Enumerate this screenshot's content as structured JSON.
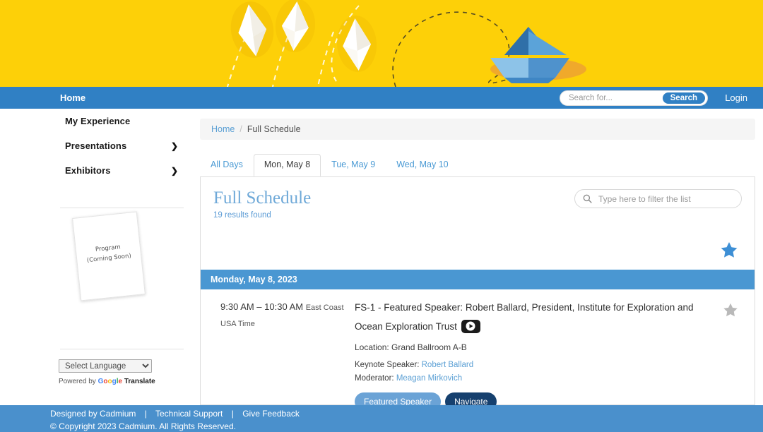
{
  "banner": {
    "alt": "origami kites and paper boat banner",
    "background_color": "#fdd008",
    "boat_color": "#4a90cc"
  },
  "navbar": {
    "home_label": "Home",
    "login_label": "Login",
    "background_color": "#3080c4",
    "search": {
      "placeholder": "Search for...",
      "value": "",
      "button_label": "Search"
    }
  },
  "sidebar": {
    "items": [
      {
        "label": "My Experience",
        "has_chevron": false
      },
      {
        "label": "Presentations",
        "has_chevron": true
      },
      {
        "label": "Exhibitors",
        "has_chevron": true
      }
    ],
    "program_card": {
      "line1": "Program",
      "line2": "(Coming Soon)"
    },
    "language": {
      "selected": "Select Language",
      "options": [
        "Select Language"
      ],
      "powered_by": "Powered by",
      "google": "Google",
      "translate": "Translate"
    }
  },
  "breadcrumb": {
    "home": "Home",
    "separator": "/",
    "current": "Full Schedule"
  },
  "tabs": [
    {
      "label": "All Days",
      "active": false
    },
    {
      "label": "Mon, May 8",
      "active": true
    },
    {
      "label": "Tue, May 9",
      "active": false
    },
    {
      "label": "Wed, May 10",
      "active": false
    }
  ],
  "panel": {
    "title": "Full Schedule",
    "results_found": "19 results found",
    "filter_placeholder": "Type here to filter the list",
    "filter_value": "",
    "star_color": "#3d8fd5"
  },
  "day_header": {
    "label": "Monday, May 8, 2023",
    "background_color": "#4a97d2"
  },
  "session": {
    "time": "9:30 AM – 10:30 AM",
    "timezone": "East Coast USA Time",
    "title": "FS-1 - Featured Speaker: Robert Ballard, President, Institute for Exploration and Ocean Exploration Trust",
    "has_video": true,
    "location_label": "Location:",
    "location": "Grand Ballroom A-B",
    "keynote_label": "Keynote Speaker:",
    "keynote_speaker": "Robert Ballard",
    "moderator_label": "Moderator:",
    "moderator": "Meagan Mirkovich",
    "tags": [
      {
        "label": "Featured Speaker",
        "style": "light"
      },
      {
        "label": "Navigate",
        "style": "dark"
      }
    ],
    "star_color": "#b9b9b9"
  },
  "footer": {
    "designed_by": "Designed by Cadmium",
    "technical_support": "Technical Support",
    "give_feedback": "Give Feedback",
    "separator": "|",
    "copyright": "© Copyright 2023 Cadmium. All Rights Reserved.",
    "background_color": "#4a90cc"
  }
}
